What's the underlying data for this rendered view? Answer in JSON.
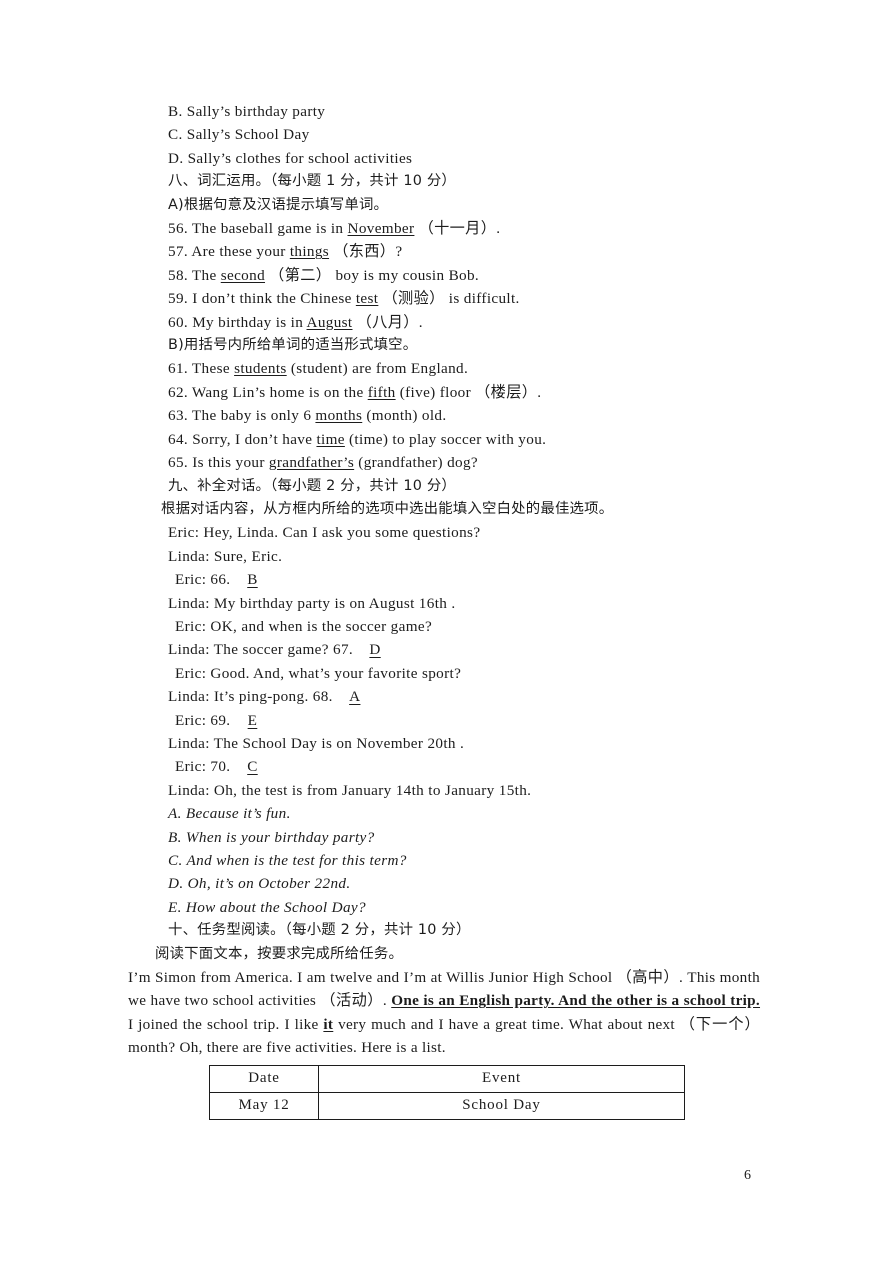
{
  "page": {
    "number": "6"
  },
  "choices_continued": [
    "B. Sally’s birthday party",
    "C. Sally’s School Day",
    "D. Sally’s clothes for school activities"
  ],
  "section_eight": {
    "heading": "八、词汇运用。（每小题 1 分，共计 10 分）",
    "part_a_instruction": "A)根据句意及汉语提示填写单词。",
    "part_a_items": [
      {
        "num": "56.",
        "pre": "The baseball game is in ",
        "answer": "November",
        "post": " （十一月）."
      },
      {
        "num": "57.",
        "pre": "Are these your ",
        "answer": "things",
        "post": " （东西）?"
      },
      {
        "num": "58.",
        "pre": "The ",
        "answer": "second",
        "post": " （第二） boy is my cousin Bob."
      },
      {
        "num": "59.",
        "pre": "I don’t think the Chinese ",
        "answer": "test",
        "post": " （测验） is difficult."
      },
      {
        "num": "60.",
        "pre": "My birthday is in ",
        "answer": "August",
        "post": " （八月）."
      }
    ],
    "part_b_instruction": "B)用括号内所给单词的适当形式填空。",
    "part_b_items": [
      {
        "num": "61.",
        "pre": "These ",
        "answer": "students",
        "post": " (student) are from England."
      },
      {
        "num": "62.",
        "pre": "Wang Lin’s home is on the ",
        "answer": "fifth",
        "post": " (five) floor （楼层）."
      },
      {
        "num": "63.",
        "pre": "The baby is only 6 ",
        "answer": "months",
        "post": " (month) old."
      },
      {
        "num": "64.",
        "pre": "Sorry, I don’t have ",
        "answer": "time",
        "post": " (time) to play soccer with you."
      },
      {
        "num": "65.",
        "pre": "Is this your ",
        "answer": "grandfather’s",
        "post": " (grandfather) dog?"
      }
    ]
  },
  "section_nine": {
    "heading": "九、补全对话。（每小题 2 分，共计 10 分）",
    "instruction": "根据对话内容，从方框内所给的选项中选出能填入空白处的最佳选项。",
    "dialogue": [
      {
        "speaker": "Eric",
        "text": "Hey, Linda. Can I ask you some questions?",
        "blank_num": "",
        "answer": ""
      },
      {
        "speaker": "Linda",
        "text": "Sure, Eric.",
        "blank_num": "",
        "answer": ""
      },
      {
        "speaker": "Eric",
        "text": "",
        "blank_num": "66.",
        "answer": "B"
      },
      {
        "speaker": "Linda",
        "text": "My birthday party is on August 16th .",
        "blank_num": "",
        "answer": ""
      },
      {
        "speaker": "Eric",
        "text": "OK, and when is the soccer game?",
        "blank_num": "",
        "answer": ""
      },
      {
        "speaker": "Linda",
        "text": "The soccer game? ",
        "blank_num": "67.",
        "answer": "D"
      },
      {
        "speaker": "Eric",
        "text": "Good. And, what’s your favorite sport?",
        "blank_num": "",
        "answer": ""
      },
      {
        "speaker": "Linda",
        "text": "It’s ping-pong. ",
        "blank_num": "68.",
        "answer": "A"
      },
      {
        "speaker": "Eric",
        "text": "",
        "blank_num": "69.",
        "answer": "E"
      },
      {
        "speaker": "Linda",
        "text": "The School Day is on November 20th .",
        "blank_num": "",
        "answer": ""
      },
      {
        "speaker": "Eric",
        "text": "",
        "blank_num": "70.",
        "answer": "C"
      },
      {
        "speaker": "Linda",
        "text": "Oh, the test is from January 14th to January 15th.",
        "blank_num": "",
        "answer": ""
      }
    ],
    "options": [
      "A. Because it’s fun.",
      "B. When is your birthday party?",
      "C. And when is the test for this term?",
      "D. Oh, it’s on October 22nd.",
      "E. How about the School Day?"
    ]
  },
  "section_ten": {
    "heading": "十、任务型阅读。（每小题 2 分，共计 10 分）",
    "instruction": "阅读下面文本，按要求完成所给任务。",
    "passage_part1": "I’m Simon from America. I am twelve and I’m at Willis Junior High School （高中）. This month we have two school activities （活动）. ",
    "passage_underlined": "One is an English party. And the other is a school trip. ",
    "passage_part2": "I joined the school trip. I like ",
    "passage_bold_it": "it",
    "passage_part3": " very much and I have a great time. What about next （下一个） month? Oh, there are five activities. Here is a list.",
    "table": {
      "headers": [
        "Date",
        "Event"
      ],
      "rows": [
        [
          "May 12",
          "School Day"
        ]
      ]
    }
  }
}
